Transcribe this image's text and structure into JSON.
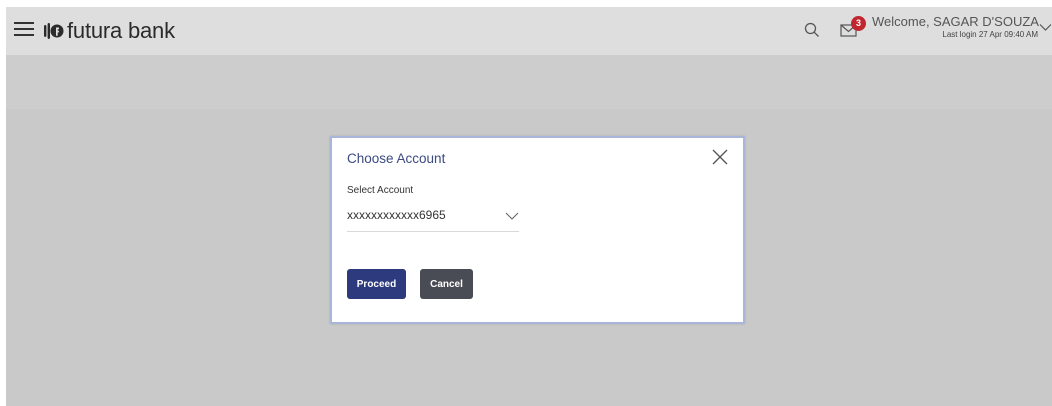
{
  "header": {
    "brand": "futura bank",
    "notification_count": "3",
    "welcome_text": "Welcome, SAGAR D'SOUZA",
    "last_login": "Last login 27 Apr 09:40 AM"
  },
  "modal": {
    "title": "Choose Account",
    "select_label": "Select Account",
    "selected_account": "xxxxxxxxxxxx6965",
    "proceed_label": "Proceed",
    "cancel_label": "Cancel"
  },
  "icons": {
    "menu": "hamburger-menu-icon",
    "logo": "futura-bank-logo-icon",
    "search": "search-icon",
    "mail": "mail-icon",
    "user_menu": "chevron-down-icon",
    "close": "close-icon",
    "dropdown": "chevron-down-icon"
  },
  "colors": {
    "primary": "#2d3a7d",
    "secondary_button": "#4a4c55",
    "badge": "#c0262d",
    "modal_title": "#3c4a82",
    "overlay": "#c9c9c9"
  }
}
